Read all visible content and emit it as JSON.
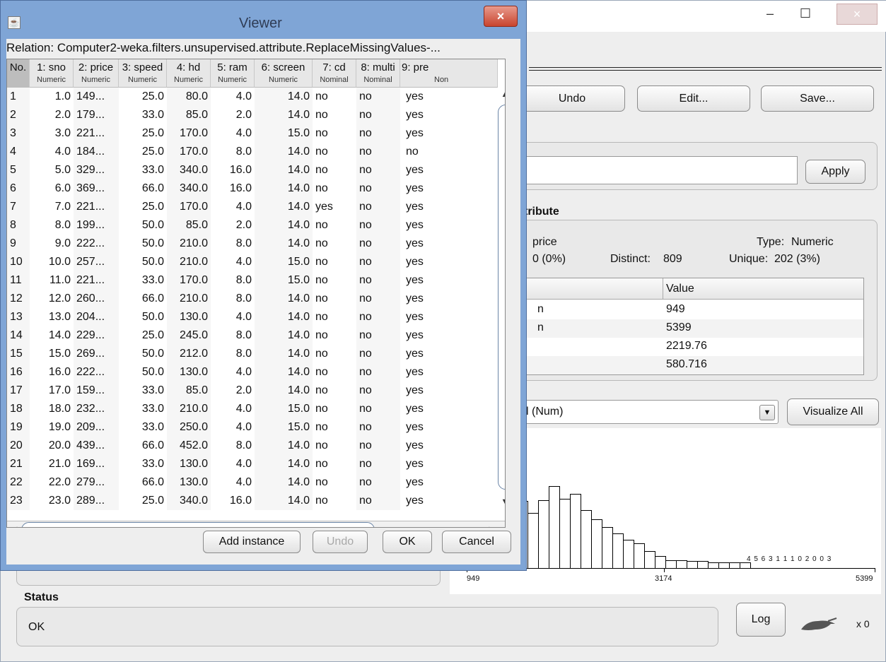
{
  "main": {
    "buttons": {
      "undo": "Undo",
      "edit": "Edit...",
      "save": "Save...",
      "apply": "Apply",
      "visualize_all": "Visualize All",
      "log": "Log"
    },
    "window_controls": {
      "minimize": "–",
      "maximize": "☐",
      "close": "×"
    },
    "selected_attribute": {
      "heading": "tribute",
      "name_label": "price",
      "missing": "0 (0%)",
      "distinct_label": "Distinct:",
      "distinct_value": "809",
      "type_label": "Type:",
      "type_value": "Numeric",
      "unique_label": "Unique:",
      "unique_value": "202 (3%)",
      "table_header": "Value",
      "rows": [
        {
          "stat": "n",
          "value": "949"
        },
        {
          "stat": "n",
          "value": "5399"
        },
        {
          "stat": "",
          "value": "2219.76"
        },
        {
          "stat": "",
          "value": "580.716"
        }
      ]
    },
    "class_select": "l (Num)",
    "histogram": {
      "min_label": "949",
      "mid_label": "3174",
      "max_label": "5399",
      "bar_heights": [
        0.4,
        0.5,
        0.61,
        0.51,
        0.55,
        0.42,
        0.35,
        0.29,
        0.24,
        0.19,
        0.16,
        0.1,
        0.06,
        0.03,
        0.03,
        0.02,
        0.02,
        0.01,
        0.01,
        0.01,
        0.01
      ],
      "small_counts": "4 5 6 3 1 1 1 0 2 0 0 3"
    },
    "status": {
      "heading": "Status",
      "text": "OK"
    },
    "x_counter": "x 0"
  },
  "viewer": {
    "title": "Viewer",
    "close": "×",
    "app_icon": "java-icon",
    "relation": "Relation: Computer2-weka.filters.unsupervised.attribute.ReplaceMissingValues-...",
    "columns": [
      {
        "name": "No.",
        "type": ""
      },
      {
        "name": "1: sno",
        "type": "Numeric"
      },
      {
        "name": "2: price",
        "type": "Numeric"
      },
      {
        "name": "3: speed",
        "type": "Numeric"
      },
      {
        "name": "4: hd",
        "type": "Numeric"
      },
      {
        "name": "5: ram",
        "type": "Numeric"
      },
      {
        "name": "6: screen",
        "type": "Numeric"
      },
      {
        "name": "7: cd",
        "type": "Nominal"
      },
      {
        "name": "8: multi",
        "type": "Nominal"
      },
      {
        "name": "9: pre",
        "type": "Non"
      }
    ],
    "rows": [
      [
        "1",
        "1.0",
        "149...",
        "25.0",
        "80.0",
        "4.0",
        "14.0",
        "no",
        "no",
        "yes"
      ],
      [
        "2",
        "2.0",
        "179...",
        "33.0",
        "85.0",
        "2.0",
        "14.0",
        "no",
        "no",
        "yes"
      ],
      [
        "3",
        "3.0",
        "221...",
        "25.0",
        "170.0",
        "4.0",
        "15.0",
        "no",
        "no",
        "yes"
      ],
      [
        "4",
        "4.0",
        "184...",
        "25.0",
        "170.0",
        "8.0",
        "14.0",
        "no",
        "no",
        "no"
      ],
      [
        "5",
        "5.0",
        "329...",
        "33.0",
        "340.0",
        "16.0",
        "14.0",
        "no",
        "no",
        "yes"
      ],
      [
        "6",
        "6.0",
        "369...",
        "66.0",
        "340.0",
        "16.0",
        "14.0",
        "no",
        "no",
        "yes"
      ],
      [
        "7",
        "7.0",
        "221...",
        "25.0",
        "170.0",
        "4.0",
        "14.0",
        "yes",
        "no",
        "yes"
      ],
      [
        "8",
        "8.0",
        "199...",
        "50.0",
        "85.0",
        "2.0",
        "14.0",
        "no",
        "no",
        "yes"
      ],
      [
        "9",
        "9.0",
        "222...",
        "50.0",
        "210.0",
        "8.0",
        "14.0",
        "no",
        "no",
        "yes"
      ],
      [
        "10",
        "10.0",
        "257...",
        "50.0",
        "210.0",
        "4.0",
        "15.0",
        "no",
        "no",
        "yes"
      ],
      [
        "11",
        "11.0",
        "221...",
        "33.0",
        "170.0",
        "8.0",
        "15.0",
        "no",
        "no",
        "yes"
      ],
      [
        "12",
        "12.0",
        "260...",
        "66.0",
        "210.0",
        "8.0",
        "14.0",
        "no",
        "no",
        "yes"
      ],
      [
        "13",
        "13.0",
        "204...",
        "50.0",
        "130.0",
        "4.0",
        "14.0",
        "no",
        "no",
        "yes"
      ],
      [
        "14",
        "14.0",
        "229...",
        "25.0",
        "245.0",
        "8.0",
        "14.0",
        "no",
        "no",
        "yes"
      ],
      [
        "15",
        "15.0",
        "269...",
        "50.0",
        "212.0",
        "8.0",
        "14.0",
        "no",
        "no",
        "yes"
      ],
      [
        "16",
        "16.0",
        "222...",
        "50.0",
        "130.0",
        "4.0",
        "14.0",
        "no",
        "no",
        "yes"
      ],
      [
        "17",
        "17.0",
        "159...",
        "33.0",
        "85.0",
        "2.0",
        "14.0",
        "no",
        "no",
        "yes"
      ],
      [
        "18",
        "18.0",
        "232...",
        "33.0",
        "210.0",
        "4.0",
        "15.0",
        "no",
        "no",
        "yes"
      ],
      [
        "19",
        "19.0",
        "209...",
        "33.0",
        "250.0",
        "4.0",
        "15.0",
        "no",
        "no",
        "yes"
      ],
      [
        "20",
        "20.0",
        "439...",
        "66.0",
        "452.0",
        "8.0",
        "14.0",
        "no",
        "no",
        "yes"
      ],
      [
        "21",
        "21.0",
        "169...",
        "33.0",
        "130.0",
        "4.0",
        "14.0",
        "no",
        "no",
        "yes"
      ],
      [
        "22",
        "22.0",
        "279...",
        "66.0",
        "130.0",
        "4.0",
        "14.0",
        "no",
        "no",
        "yes"
      ],
      [
        "23",
        "23.0",
        "289...",
        "25.0",
        "340.0",
        "16.0",
        "14.0",
        "no",
        "no",
        "yes"
      ]
    ],
    "buttons": {
      "add_instance": "Add instance",
      "undo": "Undo",
      "ok": "OK",
      "cancel": "Cancel"
    }
  }
}
